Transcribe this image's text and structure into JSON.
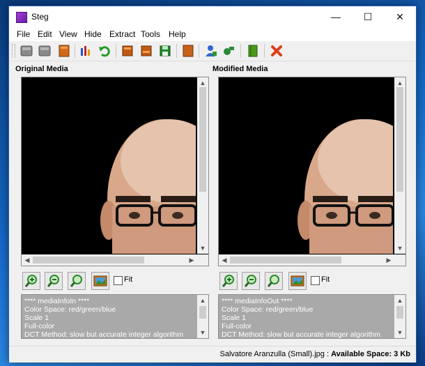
{
  "window": {
    "title": "Steg",
    "minimize": "—",
    "maximize": "☐",
    "close": "✕"
  },
  "menu": [
    "File",
    "Edit",
    "View",
    "Hide",
    "Extract",
    "Tools",
    "Help"
  ],
  "toolbar": {
    "icons": [
      "open-media-icon",
      "save-media-icon",
      "book-icon",
      "chart-icon",
      "undo-icon",
      "hide-data-icon",
      "extract-data-icon",
      "save-data-icon",
      "book-red-icon",
      "user-icon",
      "key-icon",
      "notebook-icon",
      "cancel-icon"
    ]
  },
  "panels": {
    "original": {
      "title": "Original Media",
      "fit_label": "Fit",
      "info": [
        "**** mediaInfoIn ****",
        "Color Space: red/green/blue",
        "Scale 1",
        "Full-color",
        "DCT Method: slow but accurate integer algorithm"
      ]
    },
    "modified": {
      "title": "Modified Media",
      "fit_label": "Fit",
      "info": [
        "**** mediaInfoOut ****",
        "Color Space: red/green/blue",
        "Scale 1",
        "Full-color",
        "DCT Method: slow but accurate integer algorithm"
      ]
    }
  },
  "status": {
    "filename": "Salvatore Aranzulla (Small).jpg",
    "separator": " : ",
    "space_label": "Available Space: 3 Kb"
  },
  "colors": {
    "info_bg": "#a9a9a9",
    "image_bg": "#000000",
    "accent_close": "#e03c14"
  }
}
